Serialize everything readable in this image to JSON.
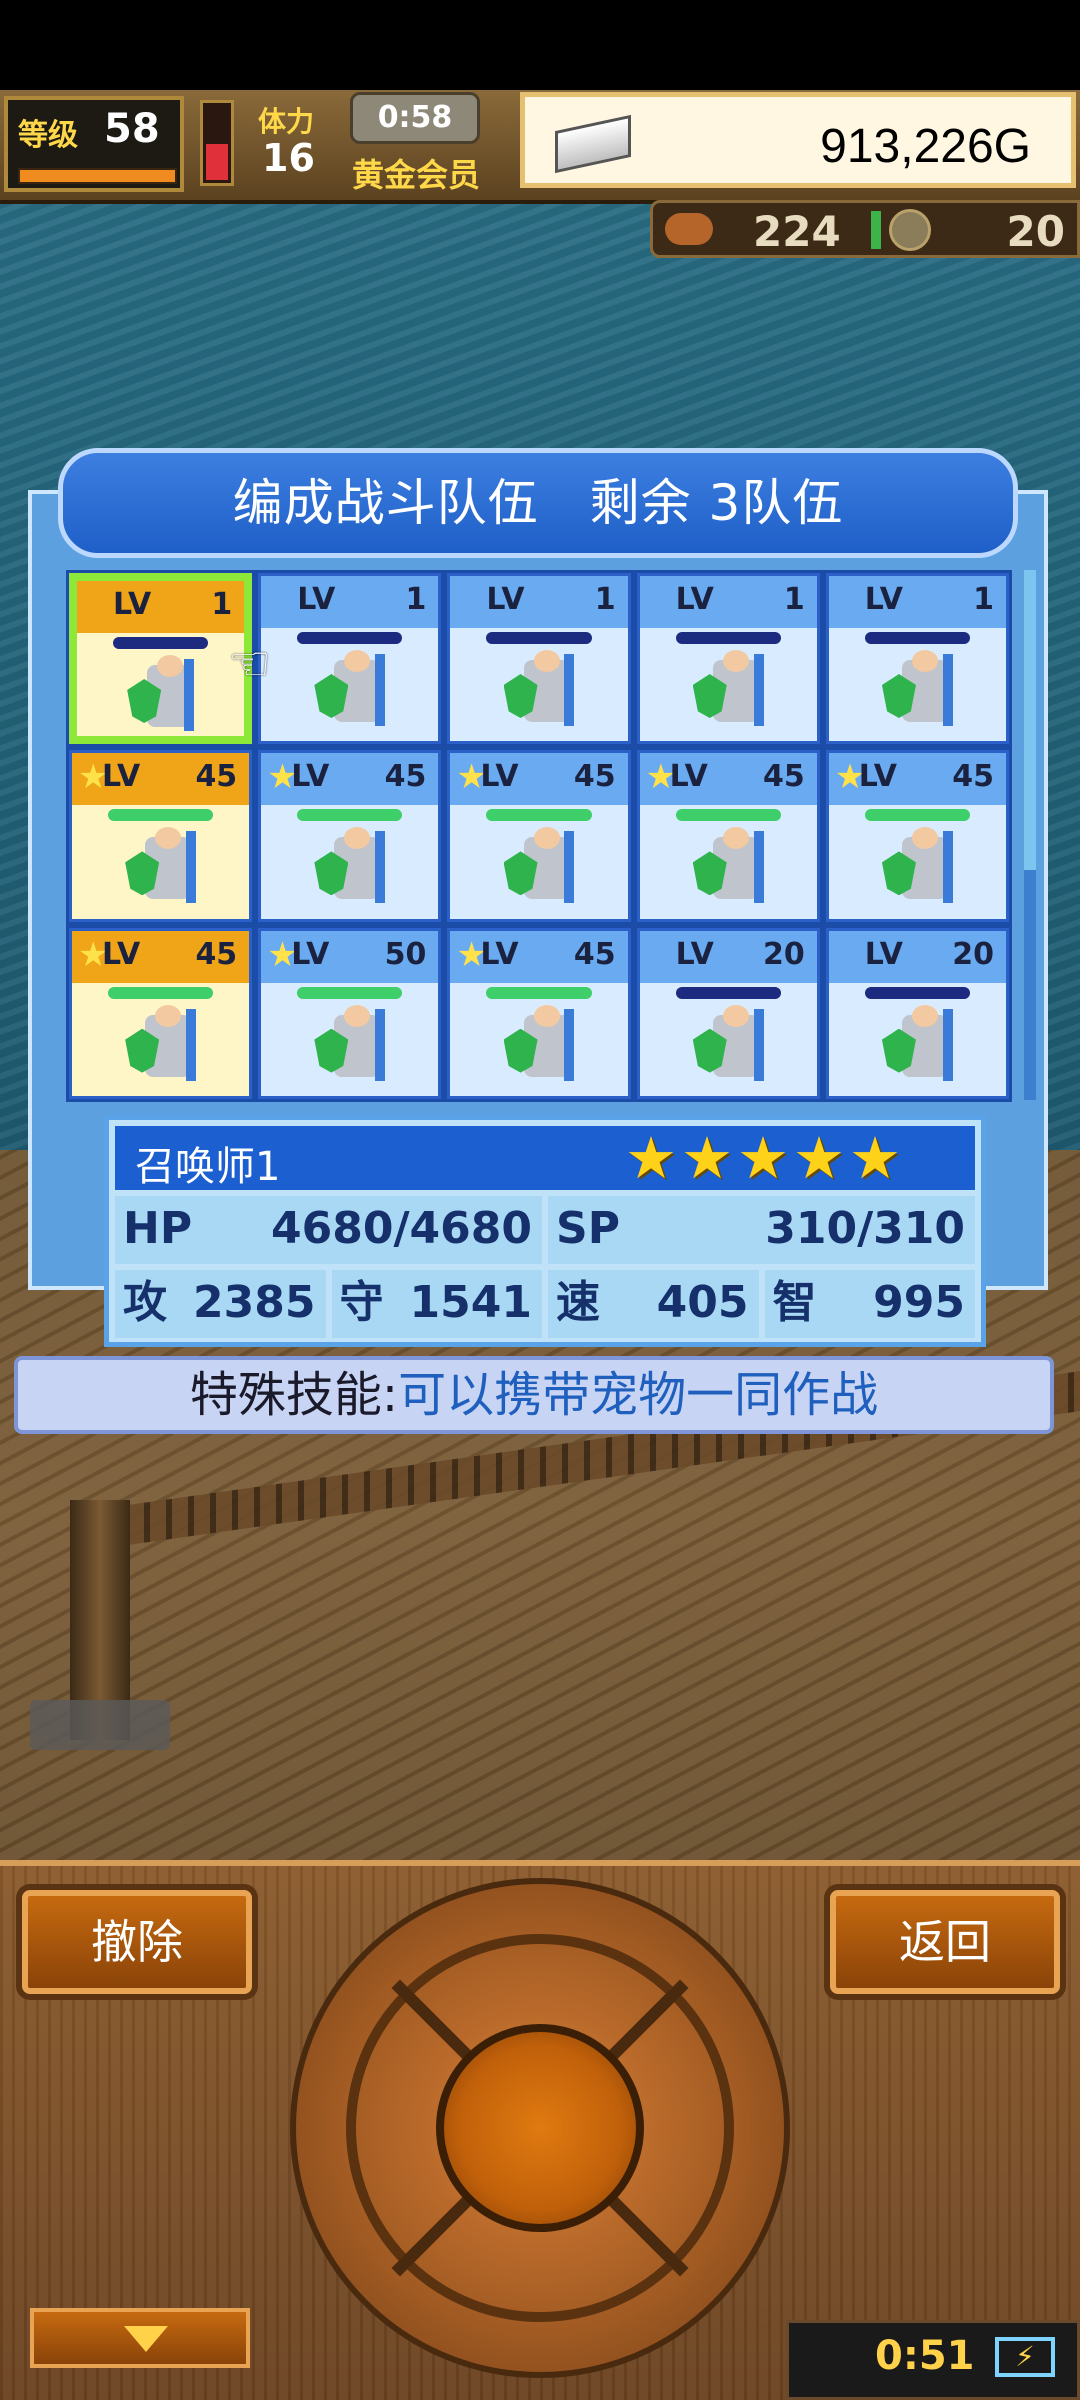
{
  "hud": {
    "level_label": "等级",
    "level": "58",
    "stamina_label": "体力",
    "stamina": "16",
    "timer": "0:58",
    "member_label": "黄金会员",
    "gold": "913,226G",
    "food": "224",
    "coins": "20"
  },
  "team": {
    "title": "编成战斗队伍　剩余 3队伍",
    "lv_label": "LV",
    "cells": [
      {
        "lv": "1",
        "star": false,
        "yellow": true,
        "selected": true
      },
      {
        "lv": "1",
        "star": false,
        "yellow": false
      },
      {
        "lv": "1",
        "star": false,
        "yellow": false
      },
      {
        "lv": "1",
        "star": false,
        "yellow": false
      },
      {
        "lv": "1",
        "star": false,
        "yellow": false
      },
      {
        "lv": "45",
        "star": true,
        "yellow": true
      },
      {
        "lv": "45",
        "star": true,
        "yellow": false
      },
      {
        "lv": "45",
        "star": true,
        "yellow": false
      },
      {
        "lv": "45",
        "star": true,
        "yellow": false
      },
      {
        "lv": "45",
        "star": true,
        "yellow": false
      },
      {
        "lv": "45",
        "star": true,
        "yellow": true
      },
      {
        "lv": "50",
        "star": true,
        "yellow": false
      },
      {
        "lv": "45",
        "star": true,
        "yellow": false
      },
      {
        "lv": "20",
        "star": false,
        "yellow": false
      },
      {
        "lv": "20",
        "star": false,
        "yellow": false
      }
    ]
  },
  "stats": {
    "name": "召唤师1",
    "stars": "★★★★★",
    "hp_label": "HP",
    "hp": "4680/4680",
    "sp_label": "SP",
    "sp": "310/310",
    "atk_label": "攻",
    "atk": "2385",
    "def_label": "守",
    "def": "1541",
    "spd_label": "速",
    "spd": "405",
    "int_label": "智",
    "int": "995"
  },
  "skill": {
    "label": "特殊技能:",
    "value": "可以携带宠物一同作战"
  },
  "controls": {
    "remove_label": "撤除",
    "back_label": "返回",
    "clock": "0:51",
    "battery_symbol": "⚡"
  },
  "colors": {
    "panel_blue": "#5ca0e0",
    "selection_green": "#8ee83a",
    "button_orange": "#c66a10",
    "star_gold": "#ffd21a"
  }
}
